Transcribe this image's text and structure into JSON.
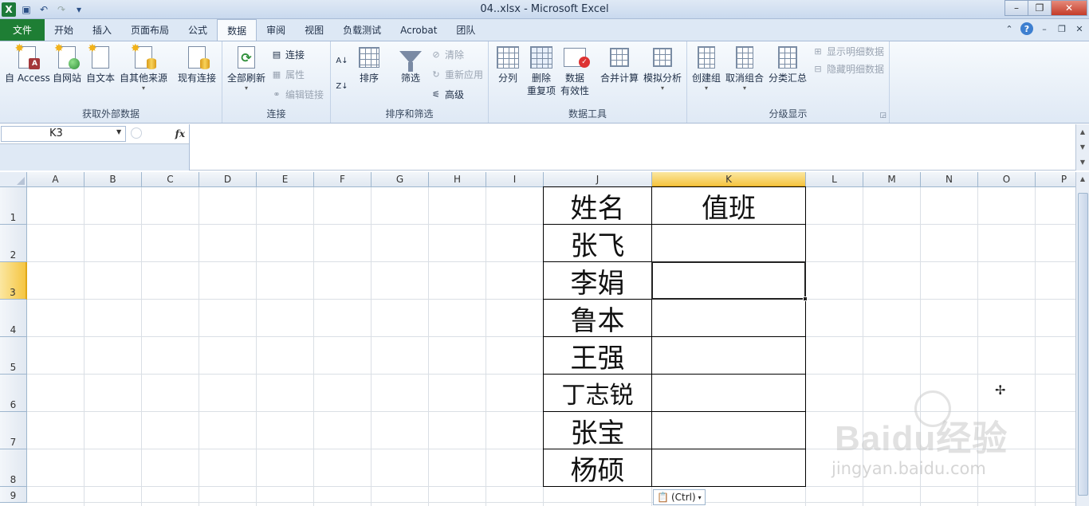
{
  "window": {
    "title": "04..xlsx  -  Microsoft Excel",
    "logo_letter": "X"
  },
  "ribbon_tabs": [
    "文件",
    "开始",
    "插入",
    "页面布局",
    "公式",
    "数据",
    "审阅",
    "视图",
    "负载测试",
    "Acrobat",
    "团队"
  ],
  "active_tab": "数据",
  "groups": {
    "external": {
      "label": "获取外部数据",
      "buttons": [
        "自 Access",
        "自网站",
        "自文本",
        "自其他来源",
        "现有连接"
      ]
    },
    "connections": {
      "label": "连接",
      "refresh": "全部刷新",
      "small": [
        "连接",
        "属性",
        "编辑链接"
      ]
    },
    "sort_filter": {
      "label": "排序和筛选",
      "sort": "排序",
      "filter": "筛选",
      "small": [
        "清除",
        "重新应用",
        "高级"
      ]
    },
    "data_tools": {
      "label": "数据工具",
      "buttons": [
        "分列",
        "删除\n重复项",
        "数据\n有效性",
        "合并计算",
        "模拟分析"
      ]
    },
    "outline": {
      "label": "分级显示",
      "buttons": [
        "创建组",
        "取消组合",
        "分类汇总"
      ],
      "small": [
        "显示明细数据",
        "隐藏明细数据"
      ]
    }
  },
  "formula_bar": {
    "name_box": "K3",
    "fx": "fx",
    "formula": ""
  },
  "columns": [
    "A",
    "B",
    "C",
    "D",
    "E",
    "F",
    "G",
    "H",
    "I",
    "J",
    "K",
    "L",
    "M",
    "N",
    "O",
    "P"
  ],
  "rows": [
    "1",
    "2",
    "3",
    "4",
    "5",
    "6",
    "7",
    "8",
    "9"
  ],
  "selected_cell": "K3",
  "table": {
    "header": [
      "姓名",
      "值班"
    ],
    "names": [
      "张飞",
      "李娟",
      "鲁本",
      "王强",
      "丁志锐",
      "张宝",
      "杨硕"
    ]
  },
  "paste_options": "(Ctrl)",
  "watermark": {
    "logo": "Baidu经验",
    "url": "jingyan.baidu.com"
  },
  "colors": {
    "file_tab": "#1e7e34",
    "selection_header": "#f5c542"
  }
}
